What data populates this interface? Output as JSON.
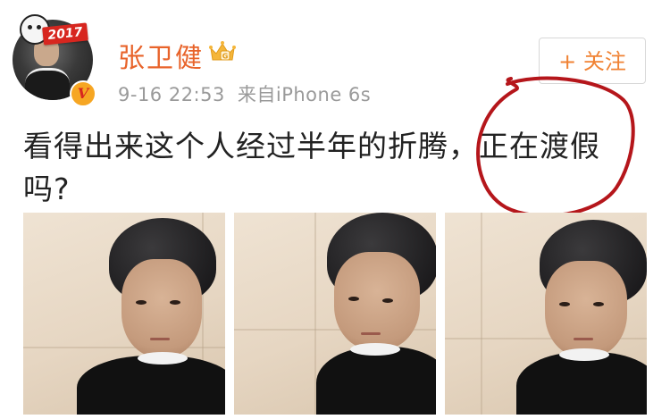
{
  "user": {
    "name": "张卫健",
    "avatar_badge_year": "2017",
    "verified_mark": "V",
    "member_icon": "crown-icon",
    "name_color": "#e8632a"
  },
  "meta": {
    "timestamp": "9-16 22:53",
    "source": "来自iPhone 6s"
  },
  "follow_button": {
    "label": "+ 关注",
    "color": "#f08233"
  },
  "post": {
    "text": "看得出来这个人经过半年的折腾，正在渡假吗?"
  },
  "annotation": {
    "type": "hand-drawn red circle",
    "color": "#b5161b",
    "target_text": "正在渡假"
  },
  "photos": [
    {
      "icon": "selfie-photo-1"
    },
    {
      "icon": "selfie-photo-2"
    },
    {
      "icon": "selfie-photo-3"
    }
  ]
}
